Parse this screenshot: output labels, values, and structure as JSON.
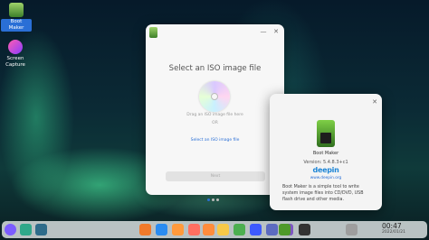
{
  "desktop": {
    "icons": [
      {
        "label_line1": "Boot",
        "label_line2": "Maker"
      },
      {
        "label_line1": "Screen",
        "label_line2": "Capture"
      }
    ]
  },
  "main_window": {
    "title": "Select an ISO image file",
    "drag_hint": "Drag an ISO image file here",
    "or_text": "OR",
    "select_link": "Select an ISO image file",
    "next_button": "Next",
    "minimize_glyph": "—",
    "close_glyph": "✕"
  },
  "about_window": {
    "close_glyph": "✕",
    "app_name": "Boot Maker",
    "version": "Version: 5.4.8.3+c1",
    "brand": "deepin",
    "website": "www.deepin.org",
    "description": "Boot Maker is a simple tool to write system image files into CD/DVD, USB flash drive and other media."
  },
  "taskbar": {
    "time": "00:47",
    "date": "2022/01/21",
    "apps": [
      {
        "icon": "launcher-icon",
        "color": "#7b5cff"
      },
      {
        "icon": "multitask-icon",
        "color": "#2fa88a"
      },
      {
        "icon": "desktop-icon",
        "color": "#2e6c8a"
      },
      {
        "icon": "file-manager-icon",
        "color": "#f07a2a"
      },
      {
        "icon": "app-store-icon",
        "color": "#2a8cf0"
      },
      {
        "icon": "browser-icon",
        "color": "#ff9a3c"
      },
      {
        "icon": "music-icon",
        "color": "#ff6f61"
      },
      {
        "icon": "calendar-icon",
        "color": "#ff8c3c"
      },
      {
        "icon": "photos-icon",
        "color": "#f7c948"
      },
      {
        "icon": "camera-icon",
        "color": "#4caf50"
      },
      {
        "icon": "video-icon",
        "color": "#3d5afe"
      },
      {
        "icon": "settings-icon",
        "color": "#5c6bc0"
      },
      {
        "icon": "control-center-icon",
        "color": "#7e57c2"
      },
      {
        "icon": "terminal-icon",
        "color": "#333333"
      },
      {
        "icon": "boot-maker-icon",
        "color": "#4e9a2a"
      },
      {
        "icon": "trash-icon",
        "color": "#9e9e9e"
      }
    ]
  }
}
